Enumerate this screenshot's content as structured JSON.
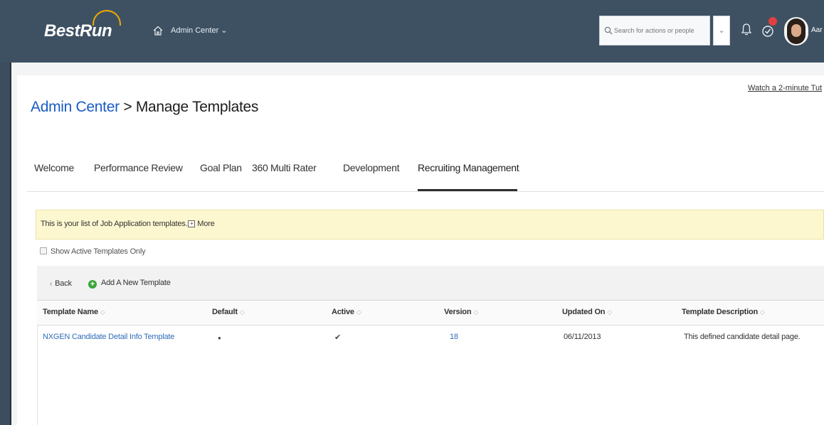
{
  "header": {
    "logo_text": "BestRun",
    "nav_label": "Admin Center ⌄",
    "search_placeholder": "Search for actions or people",
    "dropdown_glyph": "⌄",
    "user_initials": "Aar"
  },
  "colors": {
    "topbar": "#3e5163",
    "link": "#1a5bc4",
    "info_bg": "#fdf7d0",
    "add_icon": "#3aa63a",
    "badge": "#e04040"
  },
  "page": {
    "tutorial_link": "Watch a 2-minute Tut",
    "title_link": "Admin Center",
    "title_sep": " > ",
    "title_current": "Manage Templates"
  },
  "tabs": [
    {
      "label": "Welcome"
    },
    {
      "label": "Performance Review"
    },
    {
      "label": "Goal Plan"
    },
    {
      "label": "360 Multi Rater"
    },
    {
      "label": "Development"
    },
    {
      "label": "Recruiting Management",
      "active": true
    }
  ],
  "info": {
    "text": "This is your list of Job Application templates.",
    "more": "More",
    "plus_glyph": "+"
  },
  "filter": {
    "show_active_label": "Show Active Templates Only"
  },
  "toolbar": {
    "back_label": "Back",
    "back_glyph": "‹",
    "add_label": "Add A New Template",
    "add_glyph": "+"
  },
  "table": {
    "sort_glyph": "◇",
    "columns": [
      "Template Name",
      "Default",
      "Active",
      "Version",
      "Updated On",
      "Template Description"
    ],
    "rows": [
      {
        "name": "NXGEN Candidate Detail Info Template",
        "default": "●",
        "active": "✔",
        "version": "18",
        "updated_on": "06/11/2013",
        "description": "This defined candidate detail page."
      }
    ]
  },
  "icons": [
    "home-icon",
    "search-icon",
    "chevron-down-icon",
    "bell-icon",
    "todo-icon",
    "avatar",
    "plus-icon",
    "chevron-left-icon",
    "add-icon",
    "sort-icon",
    "checkbox-icon"
  ]
}
